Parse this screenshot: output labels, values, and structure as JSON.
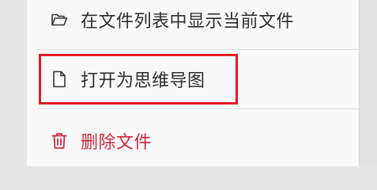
{
  "context_menu": {
    "items": [
      {
        "label": "在文件列表中显示当前文件",
        "icon": "folder-open-icon"
      },
      {
        "label": "打开为思维导图",
        "icon": "file-icon"
      },
      {
        "label": "删除文件",
        "icon": "trash-icon"
      }
    ]
  },
  "colors": {
    "danger": "#d3263b",
    "highlight_border": "#e01b24",
    "text": "#2d2d2d",
    "menu_bg": "#f9f9f9"
  }
}
